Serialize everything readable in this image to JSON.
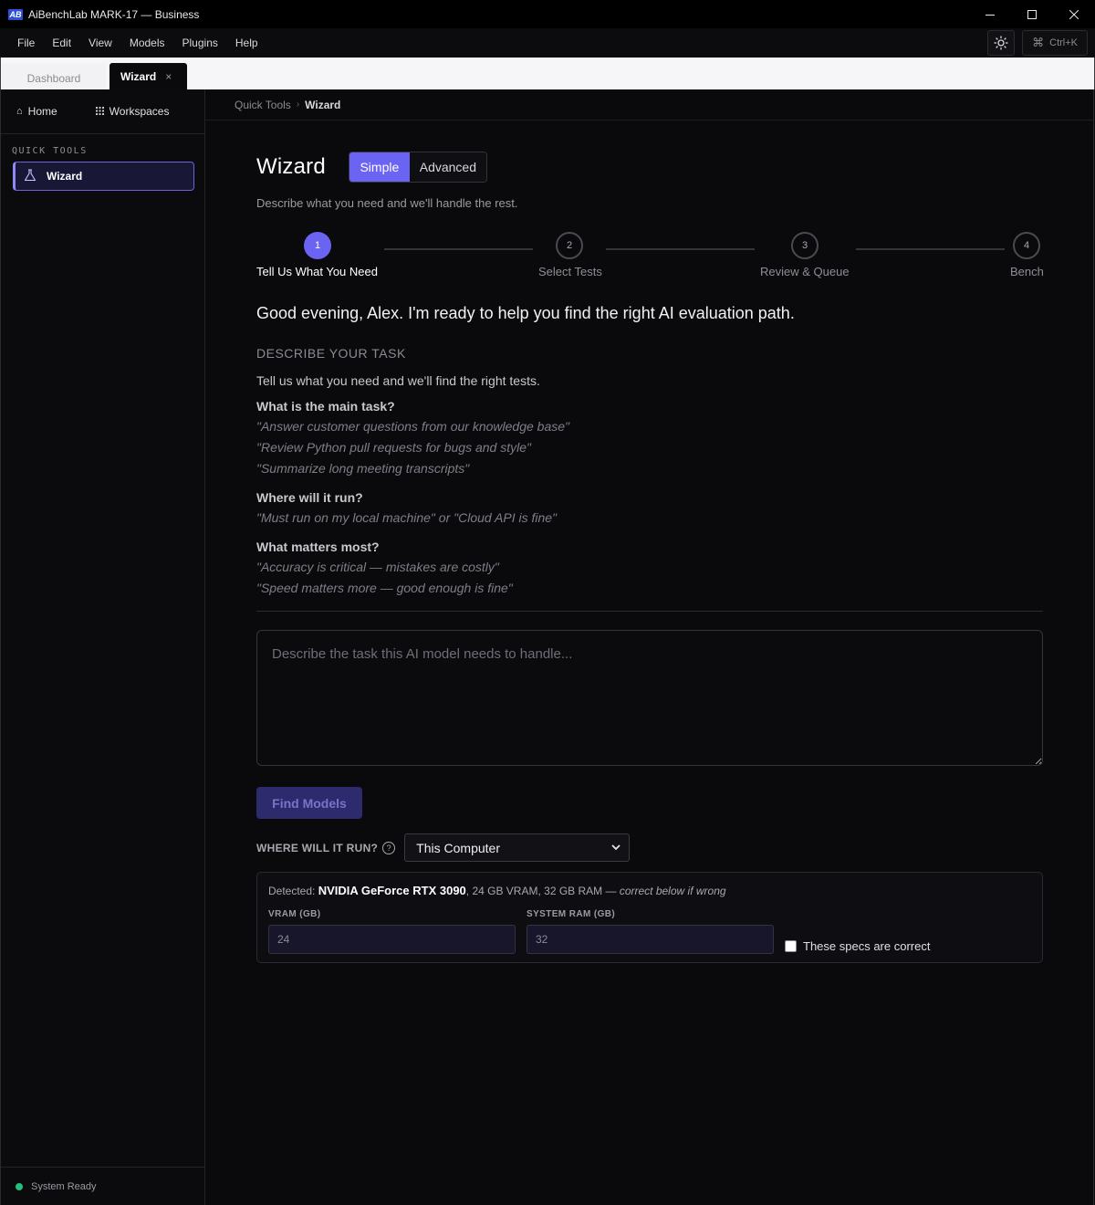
{
  "window": {
    "logo_text": "AB",
    "title": "AiBenchLab MARK-17 — Business",
    "controls": [
      "minimize-icon",
      "maximize-icon",
      "close-icon"
    ]
  },
  "menu": {
    "items": [
      "File",
      "Edit",
      "View",
      "Models",
      "Plugins",
      "Help"
    ],
    "theme_icon": "sun-icon",
    "command_shortcut": "Ctrl+K"
  },
  "tabs": [
    {
      "label": "Dashboard",
      "active": false
    },
    {
      "label": "Wizard",
      "active": true,
      "close": "×"
    }
  ],
  "sidebar": {
    "top_links": [
      {
        "label": "Home",
        "icon": "home-icon"
      },
      {
        "label": "Workspaces",
        "icon": "grid-icon"
      }
    ],
    "section_title": "QUICK TOOLS",
    "items": [
      {
        "label": "Wizard",
        "icon": "flask-icon",
        "active": true
      }
    ],
    "status": {
      "label": "System Ready",
      "color": "#22c07a"
    }
  },
  "breadcrumb": {
    "parent": "Quick Tools",
    "separator": "›",
    "current": "Wizard"
  },
  "page": {
    "title": "Wizard",
    "mode_toggle": {
      "simple": "Simple",
      "advanced": "Advanced",
      "selected": "Simple"
    },
    "subtitle": "Describe what you need and we'll handle the rest."
  },
  "stepper": {
    "current": 1,
    "steps": [
      {
        "number": "1",
        "label": "Tell Us What You Need"
      },
      {
        "number": "2",
        "label": "Select Tests"
      },
      {
        "number": "3",
        "label": "Review & Queue"
      },
      {
        "number": "4",
        "label": "Bench"
      }
    ]
  },
  "intro": {
    "greeting": "Good evening, Alex. I'm ready to help you find the right AI evaluation path.",
    "section_heading": "DESCRIBE YOUR TASK",
    "section_description": "Tell us what you need and we'll find the right tests."
  },
  "questions": [
    {
      "question": "What is the main task?",
      "examples": [
        "\"Answer customer questions from our knowledge base\"",
        "\"Review Python pull requests for bugs and style\"",
        "\"Summarize long meeting transcripts\""
      ]
    },
    {
      "question": "Where will it run?",
      "examples": [
        "\"Must run on my local machine\" or \"Cloud API is fine\""
      ]
    },
    {
      "question": "What matters most?",
      "examples": [
        "\"Accuracy is critical — mistakes are costly\"",
        "\"Speed matters more — good enough is fine\""
      ]
    }
  ],
  "task_input": {
    "placeholder": "Describe the task this AI model needs to handle...",
    "value": ""
  },
  "find_button": "Find Models",
  "run_location": {
    "label": "WHERE WILL IT RUN?",
    "help_icon": "?",
    "selected": "This Computer"
  },
  "hardware": {
    "detected_prefix": "Detected: ",
    "gpu": "NVIDIA GeForce RTX 3090",
    "specs": ", 24 GB VRAM, 32 GB RAM — ",
    "hint": "correct below if wrong",
    "vram_label": "VRAM (GB)",
    "vram_value": "24",
    "ram_label": "SYSTEM RAM (GB)",
    "ram_value": "32",
    "confirm_label": "These specs are correct",
    "confirm_checked": false
  },
  "colors": {
    "accent": "#6b63f2",
    "background": "#0a0a0d",
    "status_ok": "#22c07a"
  }
}
